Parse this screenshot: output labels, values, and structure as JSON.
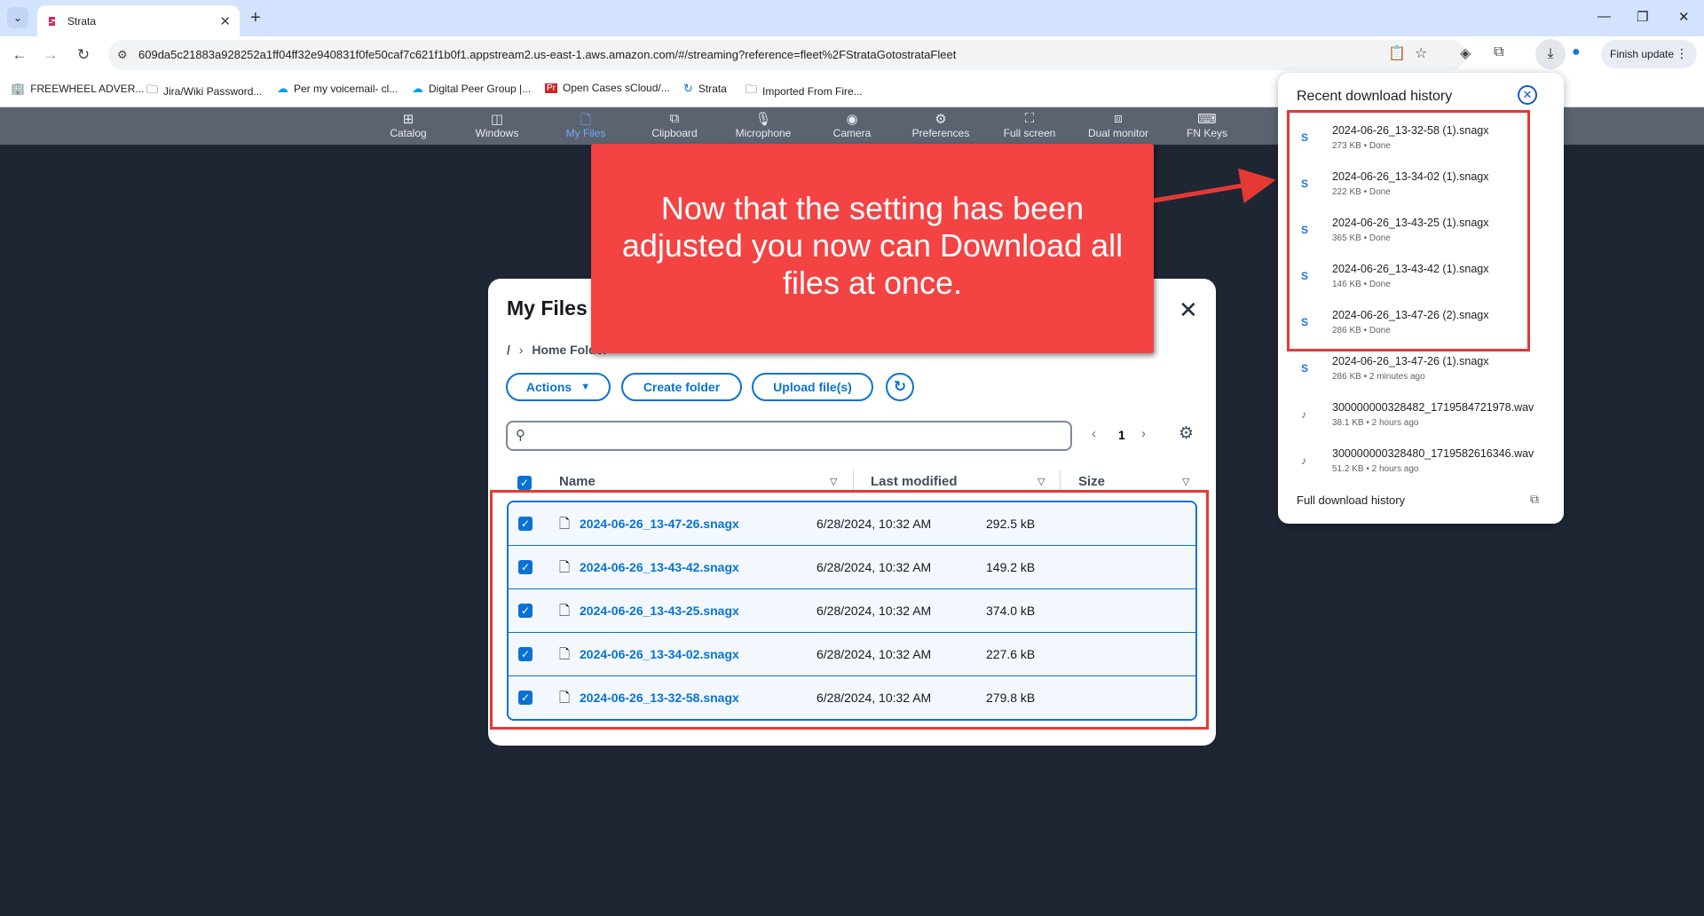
{
  "browser": {
    "tab_title": "Strata",
    "url": "609da5c21883a928252a1ff04ff32e940831f0fe50caf7c621f1b0f1.appstream2.us-east-1.aws.amazon.com/#/streaming?reference=fleet%2FStrataGotostrataFleet",
    "finish_update_label": "Finish update",
    "bookmarks": [
      {
        "label": "FREEWHEEL ADVER...",
        "icon": "building-icon"
      },
      {
        "label": "Jira/Wiki Password...",
        "icon": "folder-icon"
      },
      {
        "label": "Per my voicemail- cl...",
        "icon": "salesforce-icon"
      },
      {
        "label": "Digital Peer Group |...",
        "icon": "salesforce-icon"
      },
      {
        "label": "Open Cases sCloud/...",
        "icon": "pr-icon"
      },
      {
        "label": "Strata",
        "icon": "strata-icon"
      },
      {
        "label": "Imported From Fire...",
        "icon": "folder-icon"
      }
    ]
  },
  "appbar": {
    "items": [
      {
        "label": "Catalog",
        "icon": "catalog-icon"
      },
      {
        "label": "Windows",
        "icon": "windows-icon"
      },
      {
        "label": "My Files",
        "icon": "files-icon",
        "active": true
      },
      {
        "label": "Clipboard",
        "icon": "clipboard-icon"
      },
      {
        "label": "Microphone",
        "icon": "microphone-icon"
      },
      {
        "label": "Camera",
        "icon": "camera-icon"
      },
      {
        "label": "Preferences",
        "icon": "gear-icon"
      },
      {
        "label": "Full screen",
        "icon": "fullscreen-icon"
      },
      {
        "label": "Dual monitor",
        "icon": "dual-monitor-icon"
      },
      {
        "label": "FN Keys",
        "icon": "keyboard-icon"
      }
    ]
  },
  "dialog": {
    "title": "My Files",
    "breadcrumb": {
      "root": "/",
      "current": "Home Folder"
    },
    "actions_label": "Actions",
    "create_folder_label": "Create folder",
    "upload_label": "Upload file(s)",
    "search_placeholder": "",
    "page_number": "1",
    "columns": {
      "name": "Name",
      "modified": "Last modified",
      "size": "Size"
    },
    "files": [
      {
        "name": "2024-06-26_13-47-26.snagx",
        "modified": "6/28/2024, 10:32 AM",
        "size": "292.5 kB"
      },
      {
        "name": "2024-06-26_13-43-42.snagx",
        "modified": "6/28/2024, 10:32 AM",
        "size": "149.2 kB"
      },
      {
        "name": "2024-06-26_13-43-25.snagx",
        "modified": "6/28/2024, 10:32 AM",
        "size": "374.0 kB"
      },
      {
        "name": "2024-06-26_13-34-02.snagx",
        "modified": "6/28/2024, 10:32 AM",
        "size": "227.6 kB"
      },
      {
        "name": "2024-06-26_13-32-58.snagx",
        "modified": "6/28/2024, 10:32 AM",
        "size": "279.8 kB"
      }
    ]
  },
  "callout": {
    "text": "Now that the setting has been adjusted you now can Download all files at once."
  },
  "downloads": {
    "title": "Recent download history",
    "items": [
      {
        "name": "2024-06-26_13-32-58 (1).snagx",
        "meta": "273 KB • Done"
      },
      {
        "name": "2024-06-26_13-34-02 (1).snagx",
        "meta": "222 KB • Done"
      },
      {
        "name": "2024-06-26_13-43-25 (1).snagx",
        "meta": "365 KB • Done"
      },
      {
        "name": "2024-06-26_13-43-42 (1).snagx",
        "meta": "146 KB • Done"
      },
      {
        "name": "2024-06-26_13-47-26 (2).snagx",
        "meta": "286 KB • Done"
      },
      {
        "name": "2024-06-26_13-47-26 (1).snagx",
        "meta": "286 KB • 2 minutes ago"
      },
      {
        "name": "300000000328482_1719584721978.wav",
        "meta": "38.1 KB • 2 hours ago"
      },
      {
        "name": "300000000328480_1719582616346.wav",
        "meta": "51.2 KB • 2 hours ago"
      }
    ],
    "full_history_label": "Full download history"
  },
  "colors": {
    "accent": "#0972d3",
    "callout": "#f44343",
    "highlight": "#e53935",
    "stream_bg": "#1f2633"
  }
}
